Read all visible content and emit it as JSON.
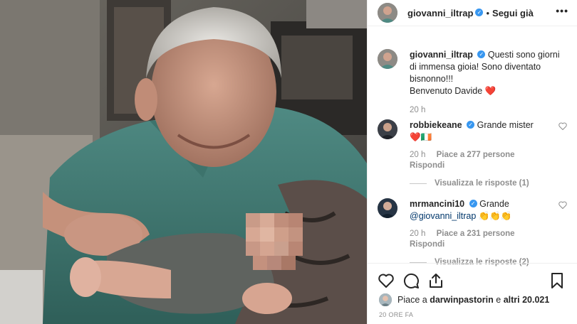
{
  "post": {
    "author": "giovanni_iltrap",
    "follow_status": "Segui già",
    "separator": "•",
    "more_glyph": "•••"
  },
  "caption": {
    "user": "giovanni_iltrap",
    "line1": "Questi sono giorni di immensa gioia! Sono diventato bisnonno!!!",
    "line2": "Benvenuto Davide",
    "emoji": "❤️",
    "time": "20 h"
  },
  "comments": [
    {
      "user": "robbiekeane",
      "text": "Grande mister",
      "emoji_line": "❤️🇮🇪",
      "time": "20 h",
      "likes": "Piace a 277 persone",
      "reply": "Rispondi",
      "view_replies": "Visualizza le risposte (1)"
    },
    {
      "user": "mrmancini10",
      "text": "Grande",
      "mention": "@giovanni_iltrap",
      "emoji": "👏👏👏",
      "time": "20 h",
      "likes": "Piace a 231 persone",
      "reply": "Rispondi",
      "view_replies": "Visualizza le risposte (2)"
    }
  ],
  "likes_summary": {
    "prefix": "Piace a",
    "user": "darwinpastorin",
    "connector": "e",
    "others": "altri 20.021"
  },
  "date": "20 ORE FA",
  "icons": {
    "like": "heart-outline-icon",
    "comment": "comment-bubble-icon",
    "share": "share-arrow-icon",
    "save": "bookmark-icon",
    "verified": "verified-badge-icon",
    "comment_like": "small-heart-icon"
  },
  "colors": {
    "text": "#262626",
    "meta": "#8e8e8e",
    "verified": "#3897f0",
    "mention": "#00376b",
    "heart": "#ed4956",
    "border": "#efefef"
  }
}
